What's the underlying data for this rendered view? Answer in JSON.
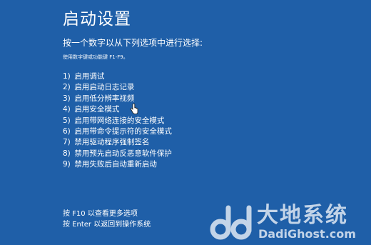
{
  "screen": {
    "title": "启动设置",
    "instruction": "按一个数字以从下列选项中进行选择:",
    "hint": "使用数字键或功能键 F1-F9。"
  },
  "options": [
    {
      "num": "1)",
      "label": "启用调试"
    },
    {
      "num": "2)",
      "label": "启用启动日志记录"
    },
    {
      "num": "3)",
      "label": "启用低分辨率视频"
    },
    {
      "num": "4)",
      "label": "启用安全模式"
    },
    {
      "num": "5)",
      "label": "启用带网络连接的安全模式"
    },
    {
      "num": "6)",
      "label": "启用带命令提示符的安全模式"
    },
    {
      "num": "7)",
      "label": "禁用驱动程序强制签名"
    },
    {
      "num": "8)",
      "label": "禁用预先启动反恶意软件保护"
    },
    {
      "num": "9)",
      "label": "禁用失败后自动重新启动"
    }
  ],
  "footer": {
    "more_options": "按 F10 以查看更多选项",
    "return": "按 Enter 以返回到操作系统"
  },
  "watermark": {
    "brand": "大地系统",
    "domain": "DadiGhost.com"
  },
  "colors": {
    "background": "#1f5fa8",
    "text": "#ffffff"
  },
  "icons": {
    "cursor": "hand-pointer-icon",
    "watermark_logo": "dd-logo-icon"
  }
}
